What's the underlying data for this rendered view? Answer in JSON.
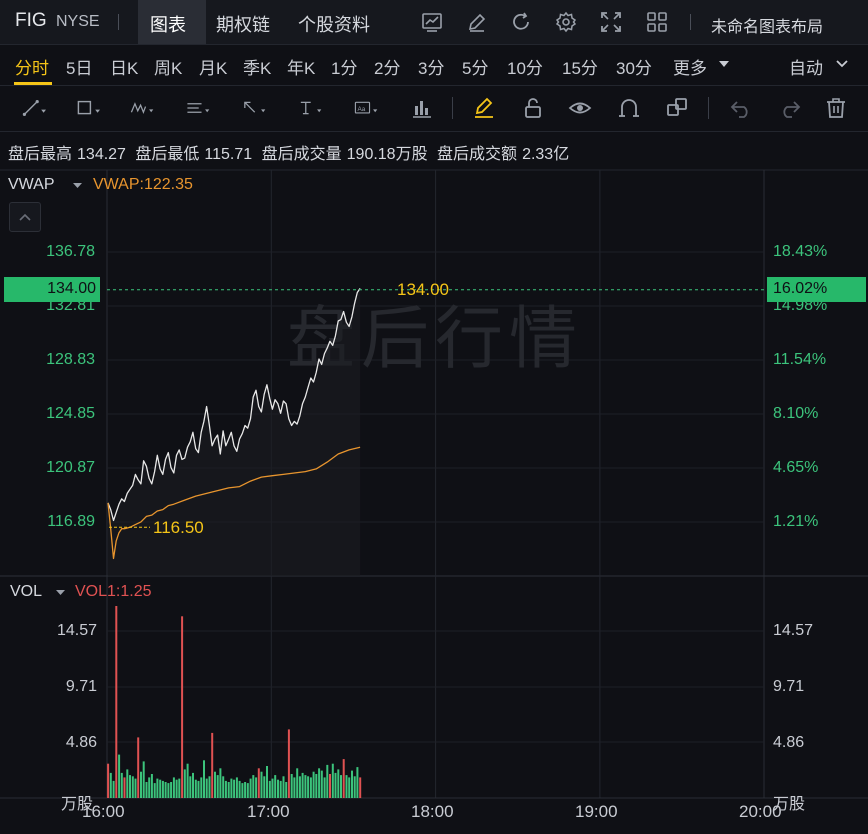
{
  "header": {
    "symbol": "FIG",
    "exchange": "NYSE",
    "tabs": [
      "图表",
      "期权链",
      "个股资料"
    ],
    "active_tab": "图表",
    "layout_name": "未命名图表布局"
  },
  "periods": [
    "分时",
    "5日",
    "日K",
    "周K",
    "月K",
    "季K",
    "年K",
    "1分",
    "2分",
    "3分",
    "5分",
    "10分",
    "15分",
    "30分",
    "更多"
  ],
  "active_period": "分时",
  "scale_mode": "自动",
  "info": {
    "high_label": "盘后最高",
    "high_value": "134.27",
    "low_label": "盘后最低",
    "low_value": "115.71",
    "vol_label": "盘后成交量",
    "vol_value": "190.18万股",
    "amt_label": "盘后成交额",
    "amt_value": "2.33亿"
  },
  "price_panel": {
    "indicator": "VWAP",
    "indicator_value": "VWAP:122.35",
    "watermark": "盘后行情",
    "current_price": "134.00",
    "current_pct": "16.02%",
    "price_marker": "134.00",
    "start_marker": "116.50"
  },
  "volume_panel": {
    "indicator": "VOL",
    "indicator_value": "VOL1:1.25",
    "unit": "万股"
  },
  "colors": {
    "up": "#e05252",
    "down": "#3cc47c",
    "price_line": "#e8e8e8",
    "vwap_line": "#e8952e",
    "highlight": "#f5c518",
    "current_bg": "#27b86a"
  },
  "chart_data": {
    "type": "line",
    "title": "",
    "x_ticks": [
      "16:00",
      "17:00",
      "18:00",
      "19:00",
      "20:00"
    ],
    "y_ticks_left": [
      "136.78",
      "132.81",
      "128.83",
      "124.85",
      "120.87",
      "116.89"
    ],
    "y_ticks_right": [
      "18.43%",
      "14.98%",
      "11.54%",
      "8.10%",
      "4.65%",
      "1.21%"
    ],
    "ylim": [
      113.5,
      139.6
    ],
    "vol_ticks": [
      "14.57",
      "9.71",
      "4.86"
    ],
    "vol_ylim": [
      0,
      17.4
    ],
    "series": [
      {
        "name": "price",
        "x": [
          0,
          1,
          2,
          3,
          4,
          5,
          6,
          7,
          8,
          9,
          10,
          11,
          12,
          13,
          14,
          15,
          16,
          17,
          18,
          19,
          20,
          21,
          22,
          23,
          24,
          25,
          26,
          27,
          28,
          29,
          30,
          31,
          32,
          33,
          34,
          35,
          36,
          37,
          38,
          39,
          40,
          41,
          42,
          43,
          44,
          45,
          46,
          47,
          48,
          49,
          50,
          51,
          52,
          53,
          54,
          55,
          56,
          57,
          58,
          59,
          60,
          61,
          62,
          63,
          64,
          65,
          66,
          67,
          68,
          69,
          70,
          71,
          72,
          73,
          74,
          75,
          76,
          77,
          78,
          79,
          80,
          81,
          82,
          83,
          84,
          85,
          86,
          87,
          88,
          89,
          90,
          91,
          92
        ],
        "values": [
          118.3,
          117.8,
          117.0,
          117.6,
          118.2,
          118.6,
          118.4,
          119.0,
          119.3,
          119.6,
          120.4,
          120.0,
          119.7,
          121.4,
          121.0,
          120.1,
          119.7,
          120.6,
          121.8,
          120.8,
          120.4,
          121.5,
          122.0,
          120.9,
          120.5,
          121.8,
          122.2,
          121.5,
          121.6,
          122.4,
          122.8,
          123.5,
          122.3,
          122.0,
          123.5,
          124.3,
          125.4,
          124.0,
          122.5,
          123.0,
          123.3,
          121.9,
          123.6,
          122.5,
          123.0,
          123.5,
          122.5,
          122.1,
          123.0,
          123.4,
          124.0,
          123.8,
          124.5,
          126.1,
          126.6,
          125.4,
          125.0,
          126.3,
          127.0,
          126.0,
          125.2,
          125.9,
          125.6,
          124.9,
          125.8,
          125.6,
          124.5,
          124.0,
          124.3,
          124.1,
          124.7,
          125.6,
          126.1,
          126.8,
          127.5,
          127.2,
          127.9,
          128.9,
          128.5,
          129.3,
          129.7,
          130.2,
          129.9,
          130.6,
          131.7,
          131.8,
          132.4,
          131.6,
          131.3,
          132.0,
          133.0,
          133.8,
          134.1
        ]
      },
      {
        "name": "VWAP",
        "x": [
          0,
          1,
          2,
          3,
          4,
          5,
          6,
          8,
          10,
          12,
          14,
          16,
          18,
          20,
          22,
          24,
          28,
          32,
          36,
          40,
          44,
          48,
          52,
          56,
          60,
          64,
          68,
          72,
          76,
          80,
          84,
          88,
          92
        ],
        "values": [
          118.3,
          116.4,
          114.2,
          115.5,
          116.1,
          116.4,
          116.4,
          116.5,
          116.7,
          116.9,
          117.3,
          117.4,
          117.7,
          117.8,
          118.1,
          118.2,
          118.5,
          118.8,
          119.0,
          119.2,
          119.4,
          119.5,
          119.9,
          120.2,
          120.3,
          120.4,
          120.5,
          120.6,
          120.8,
          121.3,
          121.9,
          122.2,
          122.4
        ]
      }
    ],
    "volume": {
      "values": [
        3.0,
        2.2,
        1.5,
        16.8,
        3.8,
        2.2,
        1.8,
        2.5,
        2.0,
        1.9,
        1.7,
        5.3,
        2.3,
        3.2,
        1.4,
        1.8,
        2.1,
        1.3,
        1.7,
        1.6,
        1.5,
        1.4,
        1.3,
        1.4,
        1.8,
        1.6,
        1.7,
        15.9,
        2.5,
        3.0,
        1.9,
        2.2,
        1.6,
        1.5,
        1.8,
        3.3,
        1.7,
        1.9,
        5.7,
        2.3,
        2.0,
        2.6,
        1.9,
        1.5,
        1.4,
        1.7,
        1.6,
        1.8,
        1.5,
        1.3,
        1.4,
        1.3,
        1.7,
        2.0,
        1.8,
        2.6,
        2.3,
        1.9,
        2.8,
        1.5,
        1.7,
        2.0,
        1.6,
        1.5,
        1.9,
        1.4,
        6.0,
        2.1,
        1.8,
        2.6,
        1.9,
        2.2,
        2.0,
        1.9,
        1.8,
        2.3,
        2.1,
        2.6,
        2.4,
        1.8,
        2.9,
        2.1,
        3.0,
        2.2,
        2.5,
        2.0,
        3.4,
        2.0,
        1.8,
        2.4,
        1.9,
        2.7,
        1.8
      ],
      "up_bars": [
        0,
        3,
        6,
        11,
        27,
        38,
        55,
        66,
        81,
        86,
        92
      ]
    }
  }
}
